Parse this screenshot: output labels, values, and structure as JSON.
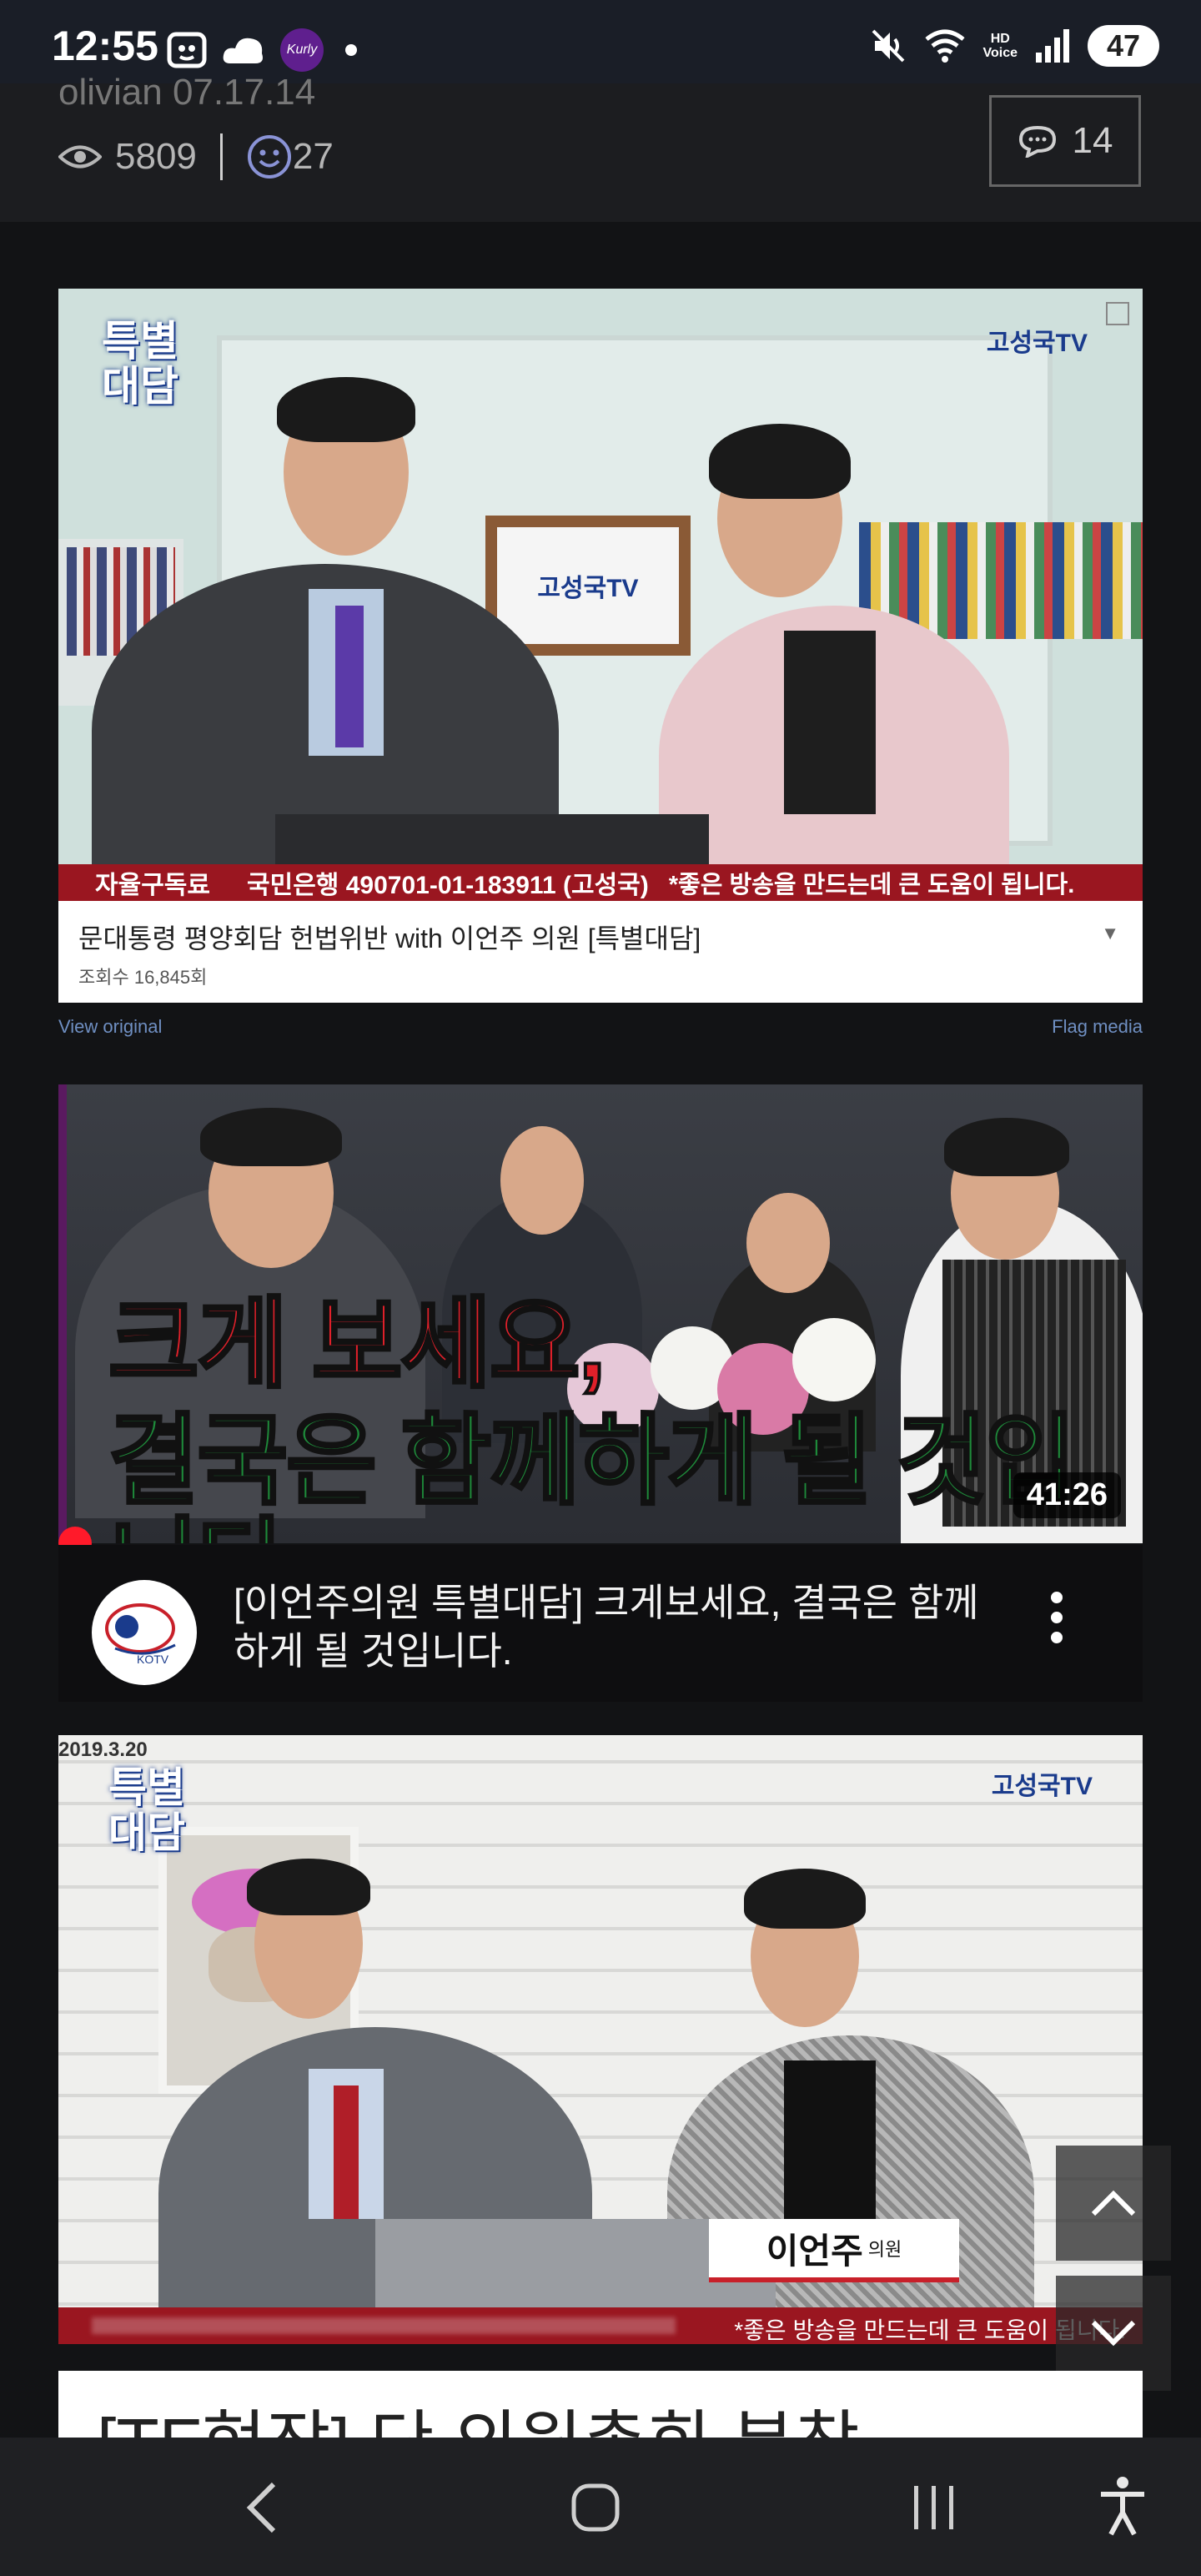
{
  "status_bar": {
    "time": "12:55",
    "kurly_label": "Kurly",
    "hd_line1": "HD",
    "hd_line2": "Voice",
    "battery": "47"
  },
  "post_meta": {
    "author_date": "olivian 07.17.14",
    "views": "5809",
    "likes": "27",
    "comments": "14"
  },
  "video1": {
    "overlay_top_left_line1": "특별",
    "overlay_top_left_line2": "대담",
    "channel_logo": "고성국TV",
    "ticker_label": "자율구독료",
    "ticker_account": "국민은행 490701-01-183911 (고성국)",
    "ticker_note": "*좋은 방송을 만드는데 큰 도움이 됩니다.",
    "title": "문대통령 평양회담 헌법위반 with 이언주 의원 [특별대담]",
    "views": "조회수 16,845회",
    "view_original": "View original",
    "flag_media": "Flag media"
  },
  "video2": {
    "headline_line1": "크게 보세요,",
    "headline_line2": "결국은 함께하게 될 것입니다.",
    "duration": "41:26",
    "title": "[이언주의원 특별대담] 크게보세요, 결국은 함께하게 될 것입니다.",
    "channel_avatar_text": "KOTV"
  },
  "video3": {
    "date": "2019.3.20",
    "overlay_top_left_line1": "특별",
    "overlay_top_left_line2": "대담",
    "channel_logo": "고성국TV",
    "name_tag": "이언주",
    "name_tag_suffix": "의원",
    "ticker_note": "*좋은 방송을 만드는데 큰 도움이 됩니다."
  },
  "next_article_title": "[TF현장] 단 의원총회 분참",
  "colors": {
    "accent_red": "#9a1620",
    "headline_red": "#e0202a",
    "headline_green": "#1e8a3a",
    "progress_red": "#ff1a2a"
  }
}
